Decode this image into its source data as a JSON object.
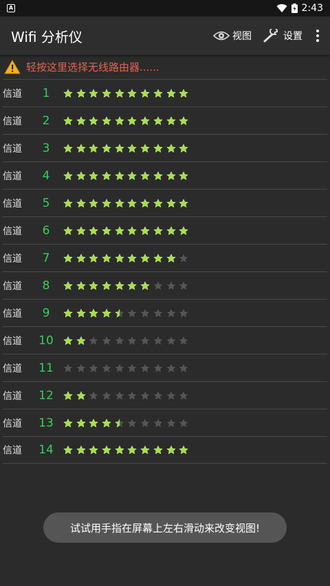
{
  "status_bar": {
    "time": "2:43",
    "left_icon": "A"
  },
  "app": {
    "title": "Wifi 分析仪",
    "actions": [
      {
        "icon": "eye-icon",
        "label": "视图"
      },
      {
        "icon": "wrench-icon",
        "label": "设置"
      }
    ]
  },
  "warning": {
    "icon": "warning-icon",
    "text": "轻按这里选择无线路由器......"
  },
  "channels": [
    {
      "label": "信道",
      "number": "1",
      "rating": 10
    },
    {
      "label": "信道",
      "number": "2",
      "rating": 10
    },
    {
      "label": "信道",
      "number": "3",
      "rating": 10
    },
    {
      "label": "信道",
      "number": "4",
      "rating": 10
    },
    {
      "label": "信道",
      "number": "5",
      "rating": 10
    },
    {
      "label": "信道",
      "number": "6",
      "rating": 10
    },
    {
      "label": "信道",
      "number": "7",
      "rating": 9
    },
    {
      "label": "信道",
      "number": "8",
      "rating": 7
    },
    {
      "label": "信道",
      "number": "9",
      "rating": 4.5
    },
    {
      "label": "信道",
      "number": "10",
      "rating": 2
    },
    {
      "label": "信道",
      "number": "11",
      "rating": 0
    },
    {
      "label": "信道",
      "number": "12",
      "rating": 2
    },
    {
      "label": "信道",
      "number": "13",
      "rating": 4.5
    },
    {
      "label": "信道",
      "number": "14",
      "rating": 10
    }
  ],
  "rating_max": 10,
  "colors": {
    "star_filled": "#a6e04a",
    "star_empty": "#555555",
    "channel_number": "#2fd35a",
    "warning_text": "#e8604e"
  },
  "toast": {
    "text": "试试用手指在屏幕上左右滑动来改变视图!"
  }
}
